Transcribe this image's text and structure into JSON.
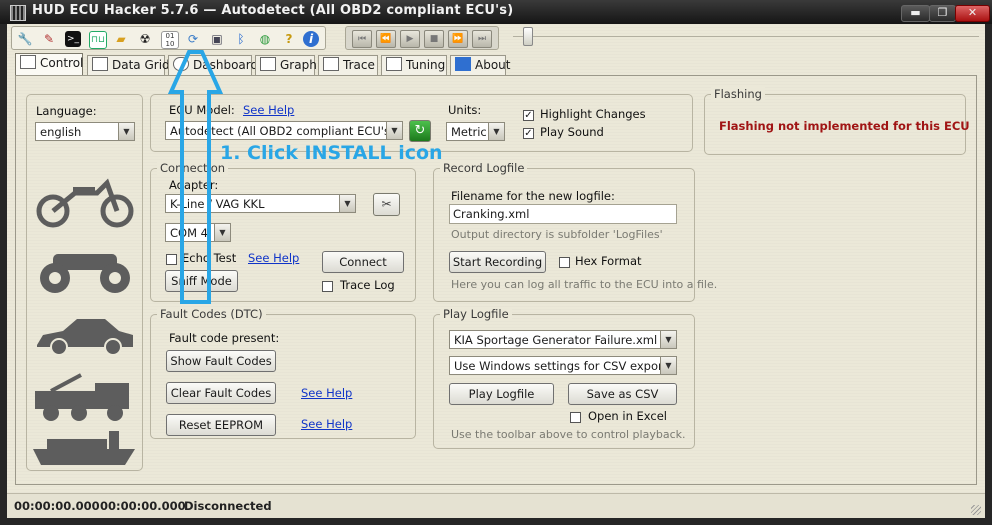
{
  "window": {
    "title": "HUD ECU Hacker 5.7.6  —  Autodetect (All OBD2 compliant ECU's)",
    "minimize": "▬",
    "maximize": "❐",
    "close": "✕"
  },
  "toolbar": {
    "icons": [
      "wrench-icon",
      "wand-icon",
      "terminal-icon",
      "pulse-icon",
      "folder-icon",
      "radiation-icon",
      "binary-icon",
      "install-icon",
      "monitor-icon",
      "bluetooth-icon",
      "globe-icon",
      "help-icon",
      "info-icon"
    ],
    "player": [
      "⏮",
      "⏪",
      "▶",
      "■",
      "⏩",
      "⏭"
    ]
  },
  "tabs": [
    {
      "label": "Control",
      "icon": "control-icon"
    },
    {
      "label": "Data Grid",
      "icon": "grid-icon"
    },
    {
      "label": "Dashboard",
      "icon": "gauge-icon"
    },
    {
      "label": "Graph",
      "icon": "graph-icon"
    },
    {
      "label": "Trace",
      "icon": "trace-icon"
    },
    {
      "label": "Tuning",
      "icon": "tuning-icon"
    },
    {
      "label": "About",
      "icon": "about-icon"
    }
  ],
  "language": {
    "label": "Language:",
    "value": "english"
  },
  "ecu": {
    "model_label": "ECU Model:",
    "see_help": "See Help",
    "model_value": "Autodetect (All OBD2 compliant ECU's)",
    "units_label": "Units:",
    "units_value": "Metric",
    "highlight_changes": "Highlight Changes",
    "play_sound": "Play Sound"
  },
  "flashing": {
    "legend": "Flashing",
    "message": "Flashing not implemented for this ECU",
    "message_color": "#a01414"
  },
  "connection": {
    "legend": "Connection",
    "adapter_label": "Adapter:",
    "adapter_value": "K-Line / VAG KKL",
    "com_value": "COM 4",
    "echo_test": "Echo Test",
    "see_help": "See Help",
    "connect": "Connect",
    "sniff_mode": "Sniff Mode",
    "trace_log": "Trace Log"
  },
  "record": {
    "legend": "Record Logfile",
    "filename_label": "Filename for the new logfile:",
    "filename_value": "Cranking.xml",
    "output_hint": "Output directory is subfolder 'LogFiles'",
    "start": "Start Recording",
    "hex_format": "Hex Format",
    "traffic_hint": "Here you can log all traffic to the ECU into a file."
  },
  "fault": {
    "legend": "Fault Codes (DTC)",
    "present_label": "Fault code present:",
    "show": "Show Fault Codes",
    "clear": "Clear Fault Codes",
    "reset": "Reset EEPROM",
    "see_help": "See Help"
  },
  "play": {
    "legend": "Play Logfile",
    "file_value": "KIA Sportage Generator Failure.xml",
    "csv_value": "Use Windows settings for CSV export",
    "play": "Play Logfile",
    "save_csv": "Save as CSV",
    "open_excel": "Open in Excel",
    "hint": "Use the toolbar above to control playback."
  },
  "status": {
    "time1": "00:00:00.000",
    "time2": "00:00:00.000",
    "connection": "Disconnected"
  },
  "annotation": {
    "text": "1. Click INSTALL icon",
    "color": "#29a6e6"
  }
}
